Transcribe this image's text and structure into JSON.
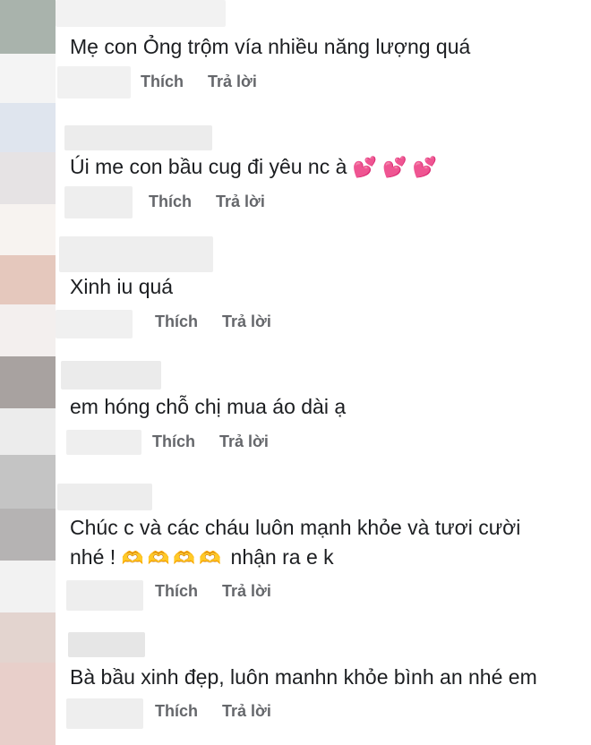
{
  "comments": [
    {
      "text": "Mẹ con Ỏng trộm vía nhiều năng lượng quá",
      "like": "Thích",
      "reply": "Trả lời"
    },
    {
      "text": "Úi me con bầu cug đi yêu nc à",
      "emoji": "💕 💕 💕",
      "like": "Thích",
      "reply": "Trả lời"
    },
    {
      "text": "Xinh iu quá",
      "like": "Thích",
      "reply": "Trả lời"
    },
    {
      "text": "em hóng chỗ chị mua áo dài ạ",
      "like": "Thích",
      "reply": "Trả lời"
    },
    {
      "text": "Chúc c và các cháu luôn mạnh khỏe và tươi cười",
      "text2": "nhé !",
      "emoji": "🫶🫶🫶🫶",
      "text3": "nhận ra e k",
      "like": "Thích",
      "reply": "Trả lời"
    },
    {
      "text": "Bà bầu xinh đẹp, luôn manhn khỏe bình an nhé em",
      "like": "Thích",
      "reply": "Trả lời"
    }
  ]
}
